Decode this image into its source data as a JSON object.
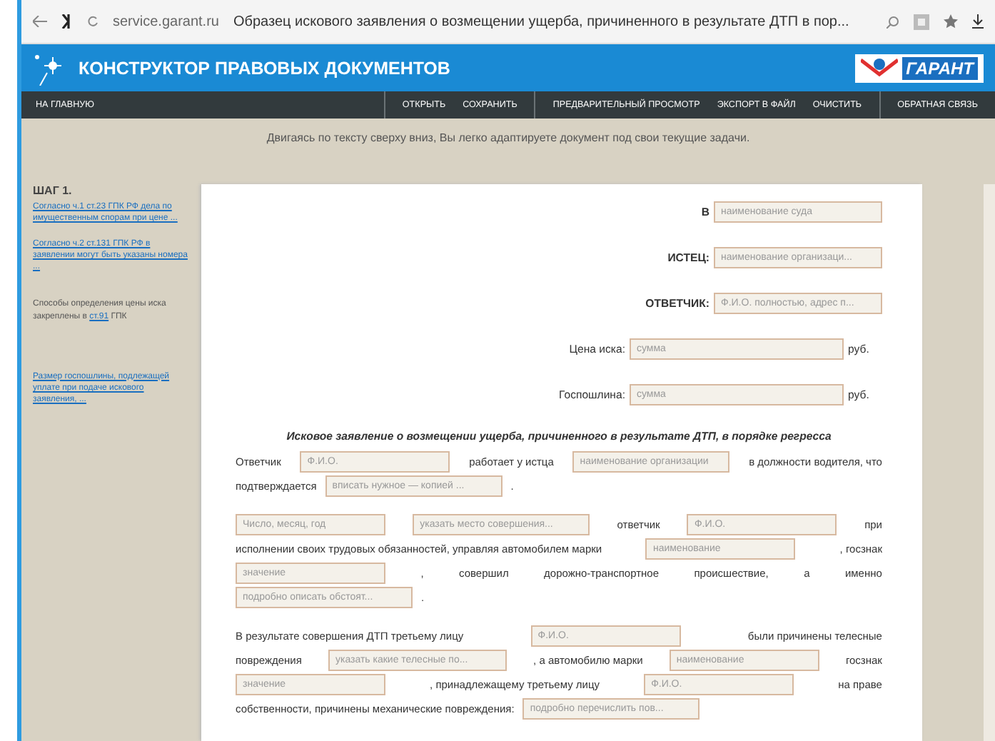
{
  "browser": {
    "url": "service.garant.ru",
    "page_title": "Образец искового заявления о возмещении ущерба, причиненного в результате ДТП в пор..."
  },
  "header": {
    "title": "КОНСТРУКТОР ПРАВОВЫХ ДОКУМЕНТОВ",
    "logo": "ГАРАНТ"
  },
  "nav": {
    "home": "НА ГЛАВНУЮ",
    "groups": [
      [
        "ОТКРЫТЬ",
        "СОХРАНИТЬ"
      ],
      [
        "ПРЕДВАРИТЕЛЬНЫЙ ПРОСМОТР",
        "ЭКСПОРТ В ФАЙЛ",
        "ОЧИСТИТЬ"
      ],
      [
        "ОБРАТНАЯ СВЯЗЬ"
      ]
    ]
  },
  "intro": "Двигаясь по тексту сверху вниз, Вы легко адаптируете документ под свои текущие задачи.",
  "sidebar": {
    "step": "ШАГ 1.",
    "notes": [
      {
        "kind": "link",
        "text": "Согласно ч.1 ст.23 ГПК РФ дела по имущественным спорам при цене ..."
      },
      {
        "kind": "link",
        "text": "Согласно ч.2 ст.131 ГПК РФ в заявлении могут быть указаны номера ..."
      },
      {
        "kind": "text",
        "text": "Способы определения цены иска закреплены в",
        "link": "ст.91",
        "after": "ГПК"
      },
      {
        "kind": "link",
        "text": "Размер госпошлины, подлежащей уплате при подаче искового заявления, ..."
      }
    ]
  },
  "header_fields": [
    {
      "label": "В",
      "placeholder": "наименование суда"
    },
    {
      "label": "ИСТЕЦ:",
      "placeholder": "наименование организаци..."
    },
    {
      "label": "ОТВЕТЧИК:",
      "placeholder": "Ф.И.О. полностью, адрес п..."
    },
    {
      "label": "Цена иска:",
      "placeholder": "сумма",
      "unit": "руб."
    },
    {
      "label": "Госпошлина:",
      "placeholder": "сумма",
      "unit": "руб."
    }
  ],
  "doc_title": "Исковое заявление о возмещении ущерба, причиненного в результате ДТП, в порядке регресса",
  "paragraphs": [
    [
      [
        {
          "kind": "text",
          "text": "Ответчик"
        },
        {
          "kind": "field",
          "placeholder": "Ф.И.О."
        },
        {
          "kind": "text",
          "text": "работает у истца"
        },
        {
          "kind": "field",
          "placeholder": "наименование организации"
        },
        {
          "kind": "text",
          "text": "в должности водителя, что"
        }
      ],
      [
        {
          "kind": "text",
          "text": "подтверждается"
        },
        {
          "kind": "field",
          "placeholder": "вписать нужное — копией ..."
        },
        {
          "kind": "text",
          "text": "."
        }
      ]
    ],
    [
      [
        {
          "kind": "field",
          "placeholder": "Число, месяц, год"
        },
        {
          "kind": "field",
          "placeholder": "указать место совершения..."
        },
        {
          "kind": "text",
          "text": "ответчик"
        },
        {
          "kind": "field",
          "placeholder": "Ф.И.О."
        },
        {
          "kind": "text",
          "text": "при"
        }
      ],
      [
        {
          "kind": "text",
          "text": "исполнении своих трудовых обязанностей, управляя автомобилем марки"
        },
        {
          "kind": "field",
          "placeholder": "наименование"
        },
        {
          "kind": "text",
          "text": ", госзнак"
        }
      ],
      [
        {
          "kind": "field",
          "placeholder": "значение"
        },
        {
          "kind": "text",
          "text": ","
        },
        {
          "kind": "text",
          "text": "совершил"
        },
        {
          "kind": "text",
          "text": "дорожно-транспортное"
        },
        {
          "kind": "text",
          "text": "происшествие,"
        },
        {
          "kind": "text",
          "text": "а"
        },
        {
          "kind": "text",
          "text": "именно"
        }
      ],
      [
        {
          "kind": "field",
          "placeholder": "подробно описать обстоят..."
        },
        {
          "kind": "text",
          "text": "."
        }
      ]
    ],
    [
      [
        {
          "kind": "text",
          "text": "В результате совершения ДТП третьему лицу"
        },
        {
          "kind": "field",
          "placeholder": "Ф.И.О."
        },
        {
          "kind": "text",
          "text": "были причинены телесные"
        }
      ],
      [
        {
          "kind": "text",
          "text": "повреждения"
        },
        {
          "kind": "field",
          "placeholder": "указать какие телесные по..."
        },
        {
          "kind": "text",
          "text": ", а автомобилю марки"
        },
        {
          "kind": "field",
          "placeholder": "наименование"
        },
        {
          "kind": "text",
          "text": "госзнак"
        }
      ],
      [
        {
          "kind": "field",
          "placeholder": "значение"
        },
        {
          "kind": "text",
          "text": ", принадлежащему третьему лицу"
        },
        {
          "kind": "field",
          "placeholder": "Ф.И.О."
        },
        {
          "kind": "text",
          "text": "на праве"
        }
      ],
      [
        {
          "kind": "text",
          "text": "собственности, причинены механические повреждения:"
        },
        {
          "kind": "field",
          "placeholder": "подробно перечислить пов..."
        }
      ]
    ]
  ]
}
